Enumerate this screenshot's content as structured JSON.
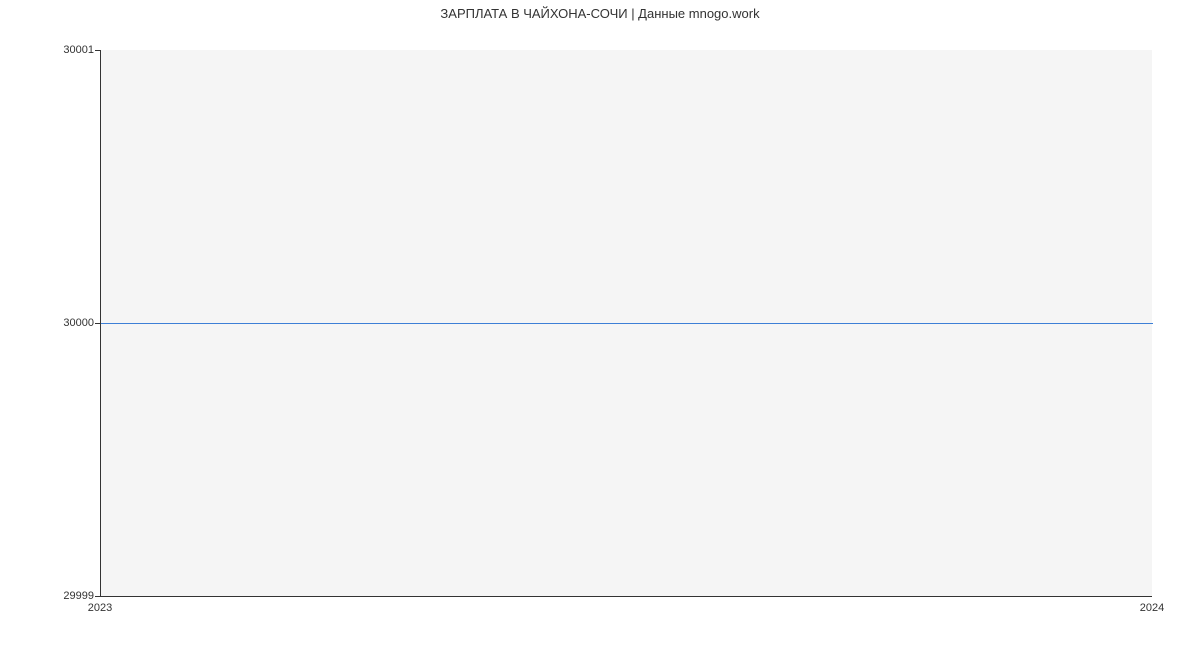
{
  "chart_data": {
    "type": "line",
    "title": "ЗАРПЛАТА В ЧАЙХОНА-СОЧИ | Данные mnogo.work",
    "xlabel": "",
    "ylabel": "",
    "x": [
      2023,
      2024
    ],
    "values": [
      30000,
      30000
    ],
    "xlim": [
      2023,
      2024
    ],
    "ylim": [
      29999,
      30001
    ],
    "x_ticks": [
      "2023",
      "2024"
    ],
    "y_ticks": [
      "29999",
      "30000",
      "30001"
    ]
  }
}
